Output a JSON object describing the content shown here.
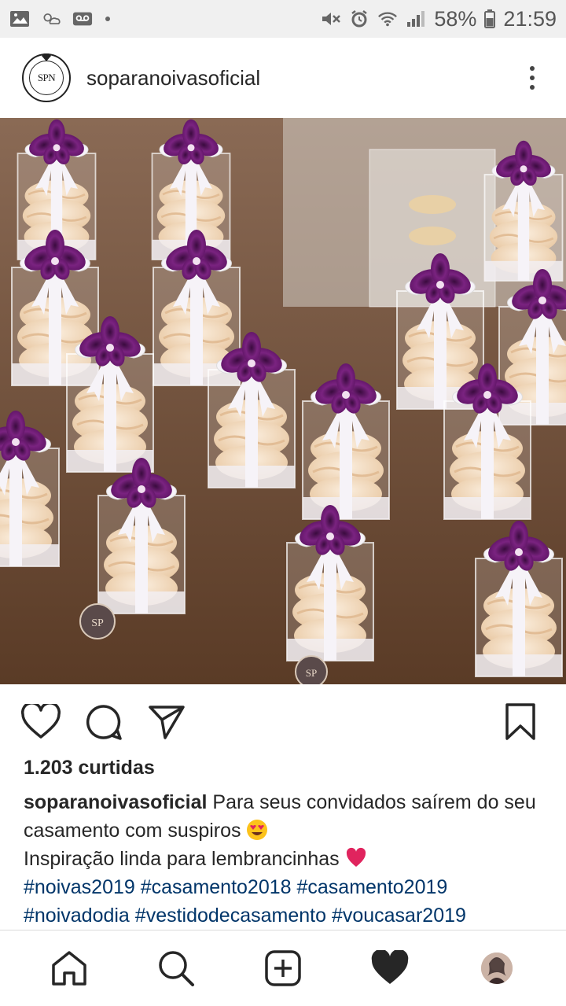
{
  "status_bar": {
    "battery_percent": "58%",
    "time": "21:59",
    "icons": [
      "image-icon",
      "weather-icon",
      "voicemail-icon",
      "dot-icon",
      "mute-icon",
      "alarm-icon",
      "wifi-icon",
      "signal-icon",
      "battery-icon"
    ]
  },
  "post": {
    "username": "soparanoivasoficial",
    "avatar_logo_text": "SPN",
    "likes": "1.203 curtidas",
    "caption_user": "soparanoivasoficial",
    "caption_line1": "Para seus convidados saírem do seu casamento com suspiros",
    "caption_line2": "Inspiração linda para lembrancinhas",
    "hashtags_line1": "#noivas2019 #casamento2018 #casamento2019",
    "hashtags_line2": "#noivadodia #vestidodecasamento #voucasar2019",
    "box_monogram": "SP"
  },
  "actions": [
    "like-icon",
    "comment-icon",
    "share-icon",
    "save-icon"
  ],
  "bottom_nav": [
    "home-icon",
    "search-icon",
    "new-post-icon",
    "activity-icon",
    "profile-icon"
  ],
  "colors": {
    "flower": "#6a1b6e",
    "ribbon": "#f3f0f6",
    "meringue": "#f4dcc0",
    "table": "#6b4a32",
    "hashtag": "#003569"
  }
}
